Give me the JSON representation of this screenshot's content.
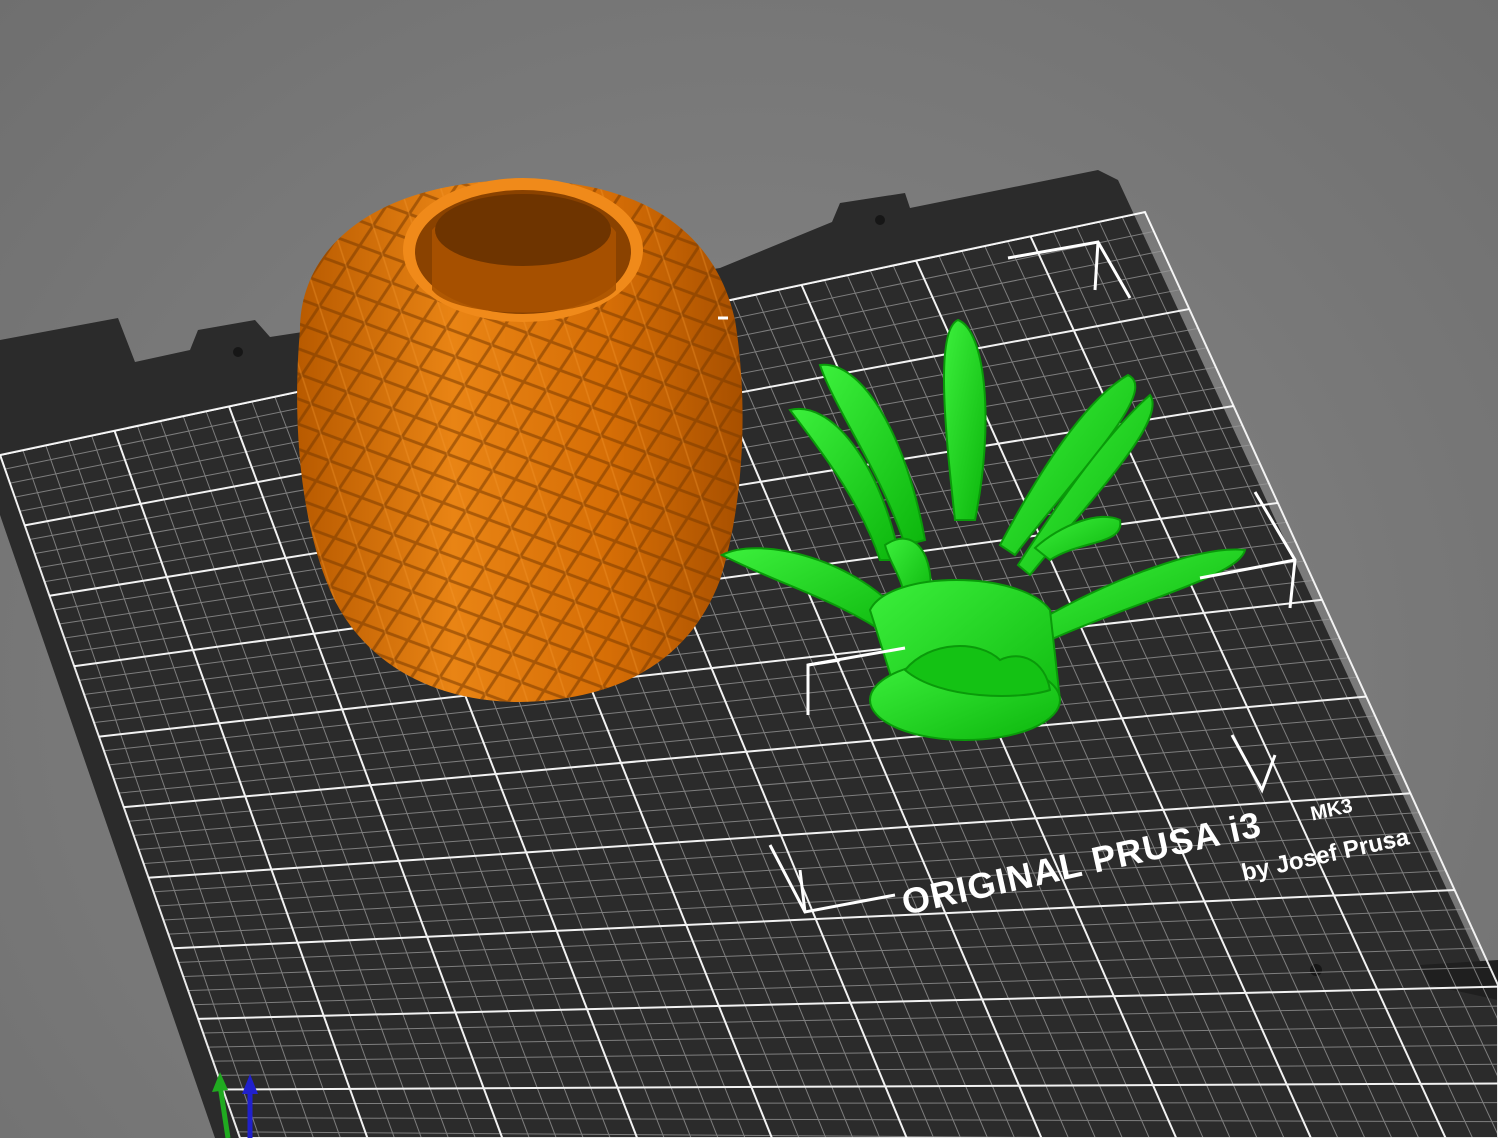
{
  "app": {
    "view": "3D preview"
  },
  "bed": {
    "brand_line": "ORIGINAL PRUSA i3",
    "model_badge": "MK3",
    "byline": "by Josef Prusa"
  },
  "objects": [
    {
      "name": "pineapple-body",
      "color": "#e07a10"
    },
    {
      "name": "pineapple-top",
      "color": "#1fd61f"
    }
  ],
  "colors": {
    "background": "#7d7d7d",
    "sheet": "#2b2b2b",
    "grid_minor": "#9a9a9a",
    "grid_major": "#ffffff",
    "selection": "#ffffff"
  },
  "axes": {
    "x": {
      "color": "#2020cc",
      "icon": "axis-z-arrow-icon"
    },
    "y": {
      "color": "#20aa20",
      "icon": "axis-y-arrow-icon"
    }
  }
}
